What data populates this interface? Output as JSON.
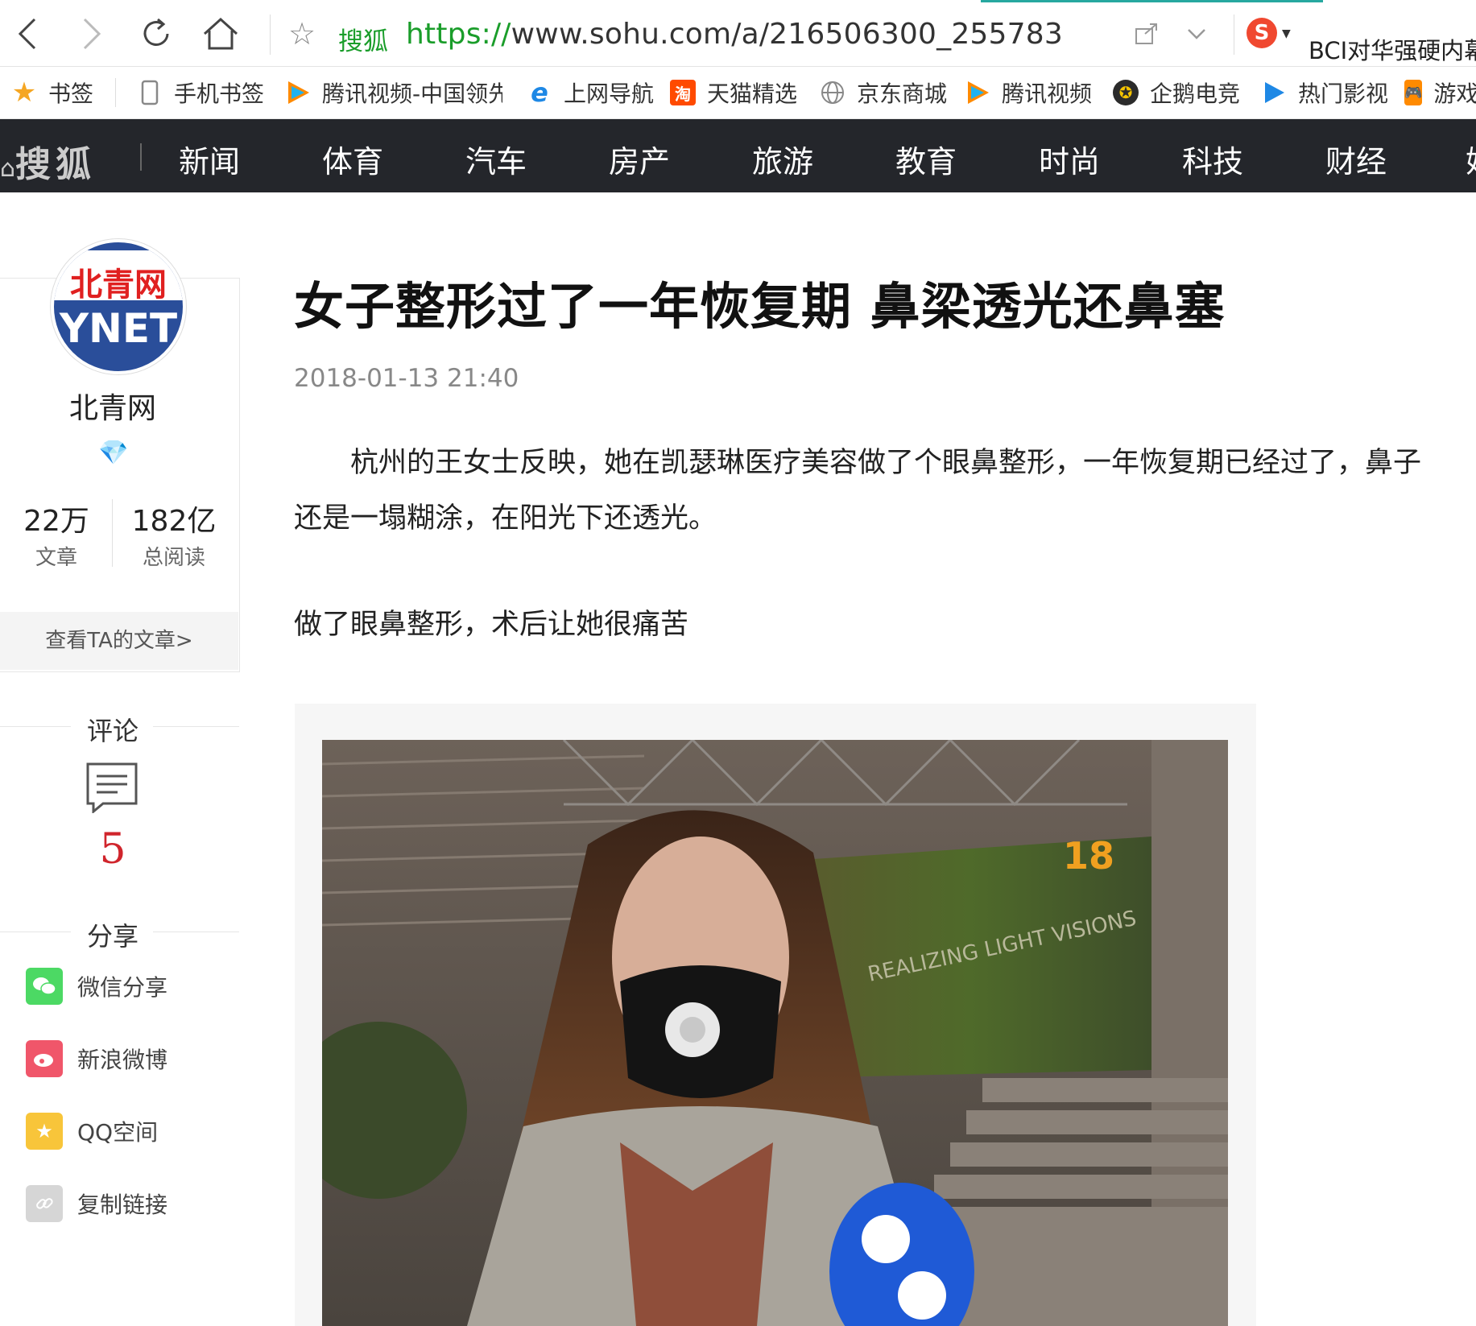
{
  "browser": {
    "site_name": "搜狐",
    "url_protocol": "https://",
    "url_rest": "www.sohu.com/a/216506300_255783",
    "hot_news": "BCI对华强硬内幕"
  },
  "bookmarks": [
    {
      "label": "书签",
      "icon": "star-icon",
      "color": "#f5a623"
    },
    {
      "label": "手机书签",
      "icon": "phone-icon",
      "color": "#999999"
    },
    {
      "label": "腾讯视频-中国领先",
      "icon": "tencent-video-icon",
      "color": "#ff7f00"
    },
    {
      "label": "上网导航",
      "icon": "ie-icon",
      "color": "#1e88e5"
    },
    {
      "label": "天猫精选",
      "icon": "tmall-icon",
      "color": "#ff5000"
    },
    {
      "label": "京东商城",
      "icon": "globe-icon",
      "color": "#999999"
    },
    {
      "label": "腾讯视频",
      "icon": "tencent-video-icon",
      "color": "#ff7f00"
    },
    {
      "label": "企鹅电竞",
      "icon": "penguin-icon",
      "color": "#333333"
    },
    {
      "label": "热门影视",
      "icon": "play-icon",
      "color": "#1e88e5"
    },
    {
      "label": "游戏",
      "icon": "gamepad-icon",
      "color": "#ff7f00"
    }
  ],
  "nav": {
    "logo": "搜狐",
    "items": [
      "新闻",
      "体育",
      "汽车",
      "房产",
      "旅游",
      "教育",
      "时尚",
      "科技",
      "财经",
      "娱"
    ]
  },
  "author": {
    "avatar_cn": "北青网",
    "avatar_en": "YNET",
    "name": "北青网",
    "articles_num": "22万",
    "articles_label": "文章",
    "reads_num": "182亿",
    "reads_label": "总阅读",
    "more_link": "查看TA的文章>"
  },
  "comments": {
    "title": "评论",
    "count": "5"
  },
  "share": {
    "title": "分享",
    "items": [
      {
        "label": "微信分享",
        "icon": "wechat-icon",
        "color": "#4cd964"
      },
      {
        "label": "新浪微博",
        "icon": "weibo-icon",
        "color": "#f0566a"
      },
      {
        "label": "QQ空间",
        "icon": "qzone-icon",
        "color": "#f8c53a"
      },
      {
        "label": "复制链接",
        "icon": "link-icon",
        "color": "#d6d6d6"
      }
    ]
  },
  "article": {
    "title": "女子整形过了一年恢复期 鼻梁透光还鼻塞",
    "date": "2018-01-13 21:40",
    "para1_line1": "　　杭州的王女士反映，她在凯瑟琳医疗美容做了个眼鼻整形，一年恢复期已经过了，鼻子",
    "para1_line2": "还是一塌糊涂，在阳光下还透光。",
    "para2": "做了眼鼻整形，术后让她很痛苦"
  },
  "photo": {
    "wall_text": "REALIZING LIGHT VISIONS",
    "logo_text": "18"
  }
}
